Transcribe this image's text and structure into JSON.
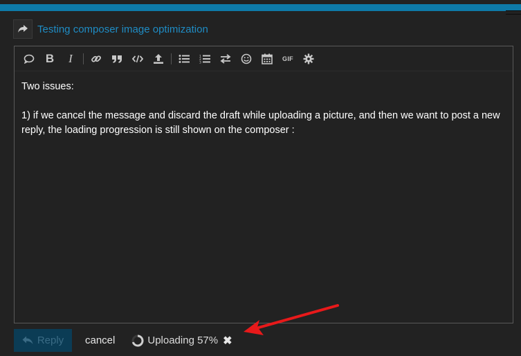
{
  "header": {
    "topic_title": "Testing composer image optimization"
  },
  "toolbar": {
    "buttons": [
      {
        "name": "quote",
        "icon": "speech-bubble-icon"
      },
      {
        "name": "bold",
        "label": "B"
      },
      {
        "name": "italic",
        "label": "I"
      },
      {
        "name": "link",
        "icon": "link-icon"
      },
      {
        "name": "blockquote",
        "icon": "quote-icon"
      },
      {
        "name": "code",
        "icon": "code-icon"
      },
      {
        "name": "upload",
        "icon": "upload-icon"
      },
      {
        "name": "bullet-list",
        "icon": "list-ul-icon"
      },
      {
        "name": "numbered-list",
        "icon": "list-ol-icon"
      },
      {
        "name": "toggle-direction",
        "icon": "exchange-icon"
      },
      {
        "name": "emoji",
        "icon": "smile-icon"
      },
      {
        "name": "date",
        "icon": "calendar-icon"
      },
      {
        "name": "gif",
        "label": "GIF"
      },
      {
        "name": "options",
        "icon": "gear-icon"
      }
    ]
  },
  "editor": {
    "paragraph_1": "Two issues:",
    "paragraph_2": "1) if we cancel the message and discard the draft while uploading a picture, and then we want to post a new reply, the loading progression is still shown on the composer :"
  },
  "footer": {
    "reply_label": "Reply",
    "cancel_label": "cancel",
    "upload_status": "Uploading 57%",
    "upload_progress_percent": 57,
    "abort_glyph": "✖"
  },
  "colors": {
    "accent": "#0e7aa8",
    "link": "#1f8cc4",
    "background": "#222222",
    "annotation_arrow": "#e8191a"
  }
}
